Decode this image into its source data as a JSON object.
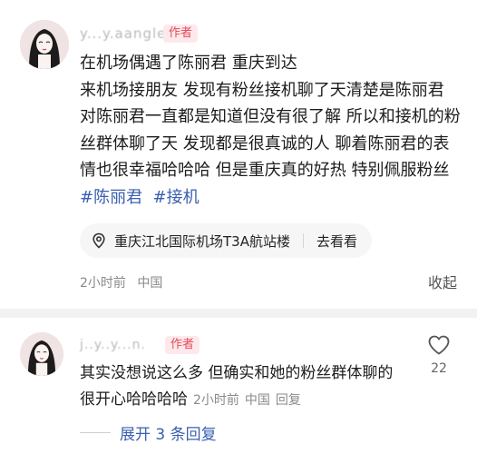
{
  "post": {
    "username": "y...y.aangle",
    "author_badge": "作者",
    "lines": [
      "在机场偶遇了陈丽君 重庆到达",
      "来机场接朋友 发现有粉丝接机聊了天清楚是陈丽君 对陈丽君一直都是知道但没有很了解 所以和接机的粉丝群体聊了天 发现都是很真诚的人 聊着陈丽君的表情也很幸福哈哈哈 但是重庆真的好热 特别佩服粉丝 "
    ],
    "hashtags": [
      "#陈丽君",
      "#接机"
    ],
    "location": {
      "icon": "location-pin-icon",
      "name": "重庆江北国际机场T3A航站楼",
      "action": "去看看"
    },
    "time": "2小时前",
    "region": "中国",
    "collapse_label": "收起"
  },
  "comment": {
    "username": "j..y..y...n.",
    "author_badge": "作者",
    "text": "其实没想说这么多 但确实和她的粉丝群体聊的很开心哈哈哈哈",
    "time": "2小时前",
    "region": "中国",
    "reply_label": "回复",
    "like_icon": "heart-outline-icon",
    "like_count": "22",
    "expand_label": "展开 3 条回复"
  },
  "colors": {
    "hashtag": "#3a5fb0",
    "badge_text": "#e24a55",
    "badge_bg": "#fde9ec"
  }
}
